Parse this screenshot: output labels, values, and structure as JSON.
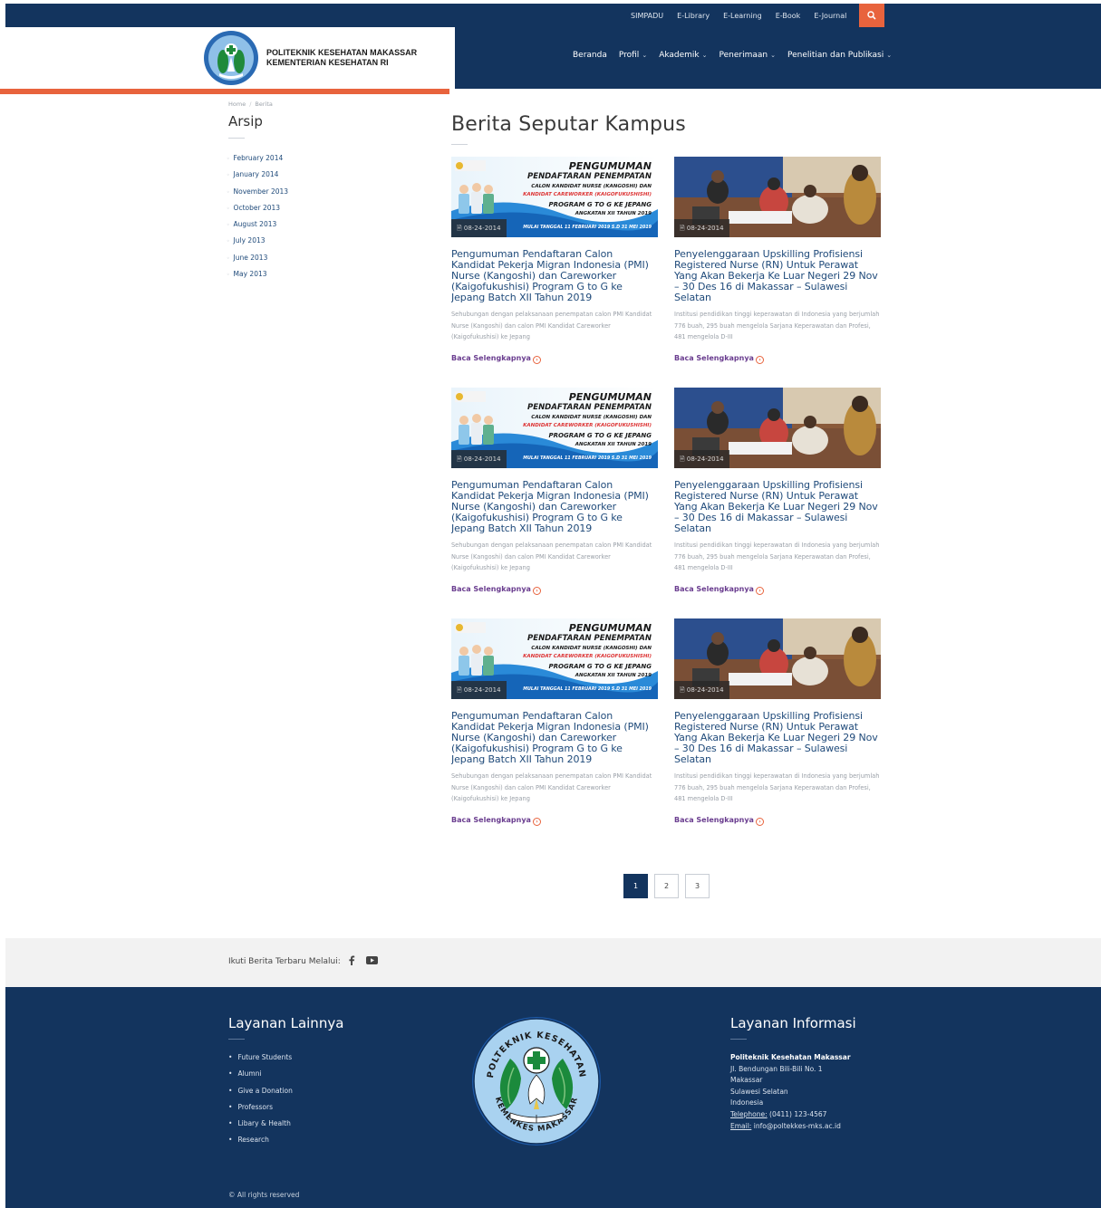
{
  "topbar": {
    "links": [
      "SIMPADU",
      "E-Library",
      "E-Learning",
      "E-Book",
      "E-Journal"
    ]
  },
  "brand": {
    "line1": "POLITEKNIK KESEHATAN MAKASSAR",
    "line2": "KEMENTERIAN KESEHATAN RI"
  },
  "nav": {
    "items": [
      "Beranda",
      "Profil",
      "Akademik",
      "Penerimaan",
      "Penelitian dan Publikasi"
    ]
  },
  "breadcrumb": {
    "home": "Home",
    "current": "Berita"
  },
  "sidebar": {
    "title": "Arsip",
    "archive": [
      "February 2014",
      "January 2014",
      "November 2013",
      "October 2013",
      "August 2013",
      "July 2013",
      "June 2013",
      "May 2013"
    ]
  },
  "main": {
    "title": "Berita Seputar Kampus",
    "posts": [
      {
        "date": "08-24-2014",
        "title": "Pengumuman Pendaftaran Calon Kandidat Pekerja Migran Indonesia (PMI) Nurse (Kangoshi) dan Careworker (Kaigofukushisi) Program G to G ke Jepang Batch XII Tahun 2019",
        "excerpt": "Sehubungan dengan pelaksanaan penempatan calon PMI Kandidat Nurse (Kangoshi) dan calon PMI Kandidat Careworker (Kaigofukushisi) ke Jepang",
        "read_more": "Baca Selengkapnya"
      },
      {
        "date": "08-24-2014",
        "title": "Penyelenggaraan Upskilling Profisiensi Registered Nurse (RN) Untuk Perawat Yang Akan Bekerja Ke Luar Negeri 29 Nov – 30 Des 16 di Makassar – Sulawesi Selatan",
        "excerpt": "Institusi pendidikan tinggi keperawatan di Indonesia yang berjumlah 776 buah, 295 buah mengelola Sarjana Keperawatan dan Profesi, 481 mengelola D-III",
        "read_more": "Baca Selengkapnya"
      }
    ],
    "poster": {
      "line1": "PENGUMUMAN",
      "line2": "PENDAFTARAN PENEMPATAN",
      "line3": "CALON KANDIDAT NURSE (KANGOSHI) DAN",
      "line4": "KANDIDAT CAREWORKER (KAIGOFUKUSHISHI)",
      "line5": "PROGRAM G TO G KE JEPANG",
      "line6": "ANGKATAN XII TAHUN 2019",
      "line7": "MULAI TANGGAL 11 FEBRUARI 2019 S.D 31 MEI 2019"
    },
    "pagination": [
      "1",
      "2",
      "3"
    ],
    "active_page": "1"
  },
  "follow": {
    "text": "Ikuti Berita Terbaru Melalui:"
  },
  "footer": {
    "services_title": "Layanan Lainnya",
    "services": [
      "Future Students",
      "Alumni",
      "Give a Donation",
      "Professors",
      "Libary & Health",
      "Research"
    ],
    "info_title": "Layanan Informasi",
    "contact": {
      "org": "Politeknik Kesehatan Makassar",
      "address1": "Jl. Bendungan Bili-Bili No. 1",
      "city": "Makassar",
      "province": "Sulawesi Selatan",
      "country": "Indonesia",
      "phone_label": "Telephone:",
      "phone": "(0411) 123-4567",
      "email_label": "Email:",
      "email": "info@poltekkes-mks.ac.id"
    },
    "logo_text_top": "POLTEKNIK KESEHATAN",
    "logo_text_bottom": "KEMENKES MAKASSAR",
    "rights": "© All rights reserved"
  },
  "colors": {
    "navy": "#13345e",
    "accent": "#e8633d",
    "link": "#1f4a7a",
    "read_more": "#6a3d8f"
  }
}
